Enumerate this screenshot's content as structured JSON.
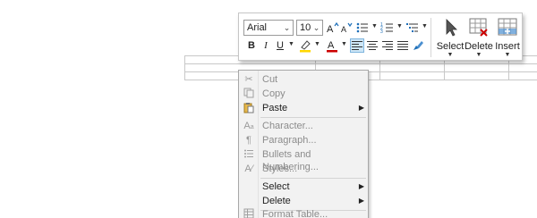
{
  "toolbar": {
    "font_name": "Arial",
    "font_size": "10",
    "select_label": "Select",
    "delete_label": "Delete",
    "insert_label": "Insert",
    "accent_color": "#1e6fb8",
    "font_color_bar": "#cc0000",
    "highlight_bar": "#ffd700"
  },
  "menu": {
    "items": [
      {
        "label": "Cut",
        "icon": "scissors-icon",
        "enabled": false
      },
      {
        "label": "Copy",
        "icon": "copy-icon",
        "enabled": false
      },
      {
        "label": "Paste",
        "icon": "paste-icon",
        "enabled": true,
        "submenu": true
      },
      {
        "label": "Character...",
        "icon": "character-icon",
        "enabled": false
      },
      {
        "label": "Paragraph...",
        "icon": "paragraph-icon",
        "enabled": false
      },
      {
        "label": "Bullets and Numbering...",
        "icon": "bullets-icon",
        "enabled": false
      },
      {
        "label": "Styles...",
        "icon": "styles-icon",
        "enabled": false
      },
      {
        "label": "Select",
        "icon": "",
        "enabled": true,
        "submenu": true
      },
      {
        "label": "Delete",
        "icon": "",
        "enabled": true,
        "submenu": true
      },
      {
        "label": "Format Table...",
        "icon": "table-icon",
        "enabled": false
      }
    ]
  }
}
